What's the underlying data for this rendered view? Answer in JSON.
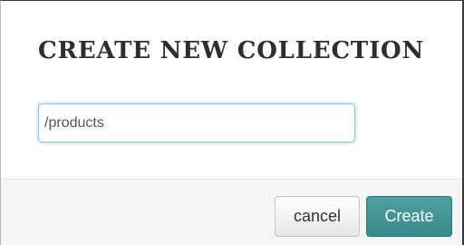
{
  "dialog": {
    "title": "CREATE NEW COLLECTION",
    "input": {
      "value": "/products",
      "placeholder": ""
    },
    "buttons": {
      "cancel_label": "cancel",
      "create_label": "Create"
    }
  },
  "colors": {
    "accent": "#3f9190",
    "focus_ring": "#8fc3ea",
    "title_text": "#2e2e2e"
  }
}
